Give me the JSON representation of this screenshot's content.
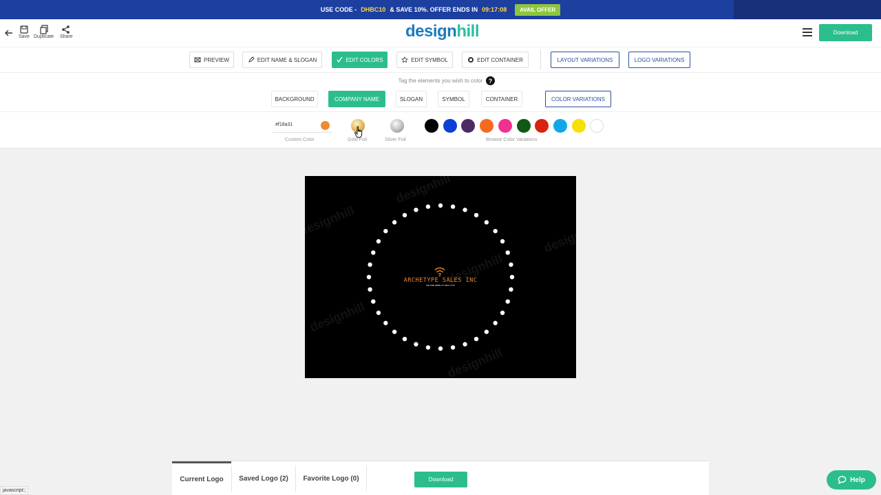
{
  "promo": {
    "prefix": "USE CODE -",
    "code": "DHBC10",
    "middle": "& SAVE 10%. OFFER ENDS IN",
    "time": "09:17:08",
    "cta": "AVAIL OFFER"
  },
  "header": {
    "back_icon": "arrow-left-icon",
    "save_label": "Save",
    "duplicate_label": "Duplicate",
    "share_label": "Share",
    "logo_part1": "design",
    "logo_part2": "hill",
    "download_label": "Download"
  },
  "toolbar": {
    "preview": "PREVIEW",
    "edit_name": "EDIT NAME & SLOGAN",
    "edit_colors": "EDIT COLORS",
    "edit_symbol": "EDIT SYMBOL",
    "edit_container": "EDIT CONTAINER",
    "layout_variations": "LAYOUT VARIATIONS",
    "logo_variations": "LOGO VARIATIONS"
  },
  "elements": {
    "hint": "Tag the elements you wish to color",
    "help_mark": "?",
    "background": "BACKGROUND",
    "company_name": "COMPANY NAME",
    "slogan": "SLOGAN",
    "symbol": "SYMBOL",
    "container": "CONTAINER",
    "color_variations": "COLOR VARIATIONS"
  },
  "colors": {
    "hex_value": "#f18a31",
    "custom_label": "Custom Color",
    "gold_label": "Gold Foil",
    "silver_label": "Silver Foil",
    "browse_label": "Browse Color Variations",
    "swatches": [
      "#000000",
      "#0b3fd6",
      "#4a2b66",
      "#f56a1d",
      "#f2308f",
      "#0e5a14",
      "#d9230f",
      "#14a7e8",
      "#f7e004",
      "#ffffff"
    ]
  },
  "canvas": {
    "company_name": "ARCHETYPE SALES INC",
    "slogan": "WE ARE HERE TO HELP YOU",
    "watermark": "designhill",
    "accent": "#f18a31"
  },
  "bottom": {
    "current": "Current Logo",
    "saved": "Saved Logo (2)",
    "favorite": "Favorite Logo (0)",
    "download": "Download"
  },
  "help": {
    "label": "Help"
  },
  "status": {
    "text": "javascript:;"
  }
}
